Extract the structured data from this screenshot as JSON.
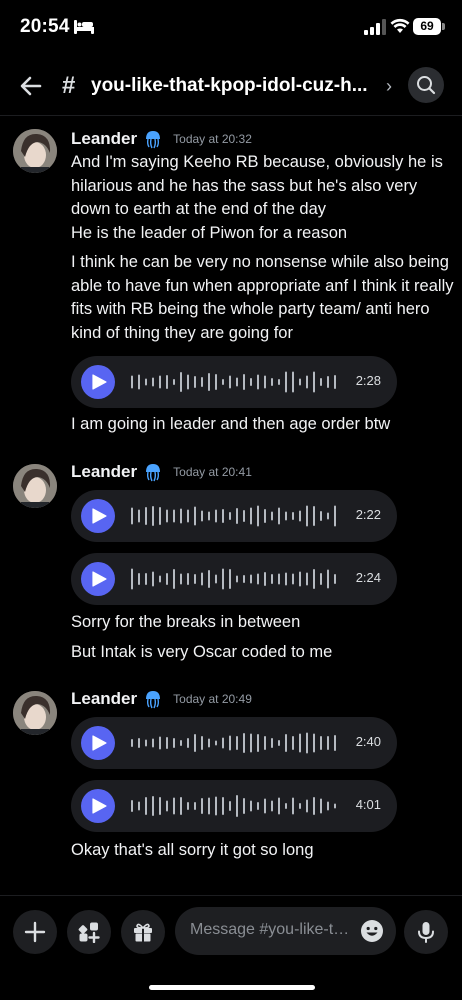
{
  "status": {
    "time": "20:54",
    "battery": "69"
  },
  "header": {
    "channel": "you-like-that-kpop-idol-cuz-h..."
  },
  "groups": [
    {
      "author": "Leander",
      "time": "Today at 20:32",
      "text1": "And I'm saying Keeho RB because, obviously he is hilarious and he has the sass but he's also very down to earth at the end of the day",
      "text2": "He is the leader of Piwon for a reason",
      "text3": "I think he can be very no nonsense while also being able to have fun when appropriate anf I think it really fits with RB being the whole party team/ anti hero kind of thing they are going for",
      "voice": [
        "2:28"
      ],
      "text4": "I am going in leader and then age order btw"
    },
    {
      "author": "Leander",
      "time": "Today at 20:41",
      "voice": [
        "2:22",
        "2:24"
      ],
      "text1": "Sorry for the breaks in between",
      "text2": "But Intak is very Oscar coded to me"
    },
    {
      "author": "Leander",
      "time": "Today at 20:49",
      "voice": [
        "2:40",
        "4:01"
      ],
      "text1": "Okay that's all sorry it got so long"
    }
  ],
  "composer": {
    "placeholder": "Message #you-like-that-kpop-idol-cuz-h"
  },
  "colors": {
    "accent": "#5865f2",
    "background": "#000000",
    "bubble": "#1c1d21"
  }
}
